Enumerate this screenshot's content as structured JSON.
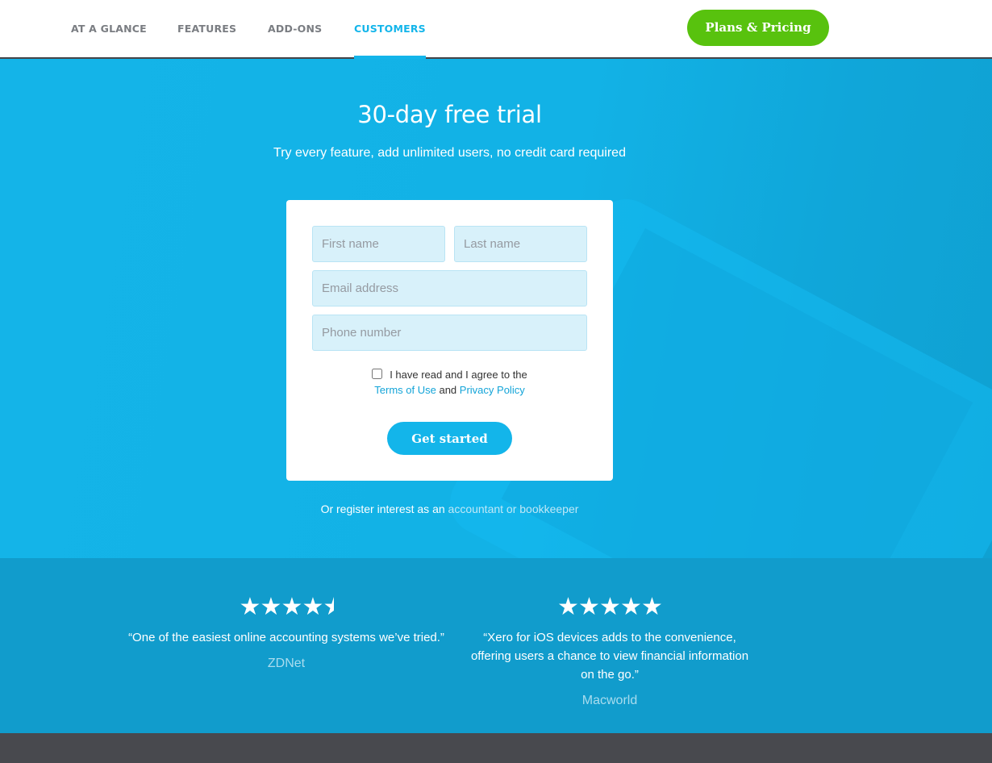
{
  "nav": {
    "items": [
      {
        "label": "AT A GLANCE",
        "active": false
      },
      {
        "label": "FEATURES",
        "active": false
      },
      {
        "label": "ADD-ONS",
        "active": false
      },
      {
        "label": "CUSTOMERS",
        "active": true
      }
    ],
    "cta_label": "Plans & Pricing",
    "cta_color": "#58c20e",
    "accent_color": "#13b5ea"
  },
  "hero": {
    "title": "30-day free trial",
    "subtitle": "Try every feature, add unlimited users, no credit card required",
    "background_color": "#13b5ea"
  },
  "form": {
    "first_name_placeholder": "First name",
    "last_name_placeholder": "Last name",
    "email_placeholder": "Email address",
    "phone_placeholder": "Phone number",
    "first_name_value": "",
    "last_name_value": "",
    "email_value": "",
    "phone_value": "",
    "agree_text": "I have read and I agree to the",
    "agree_checked": false,
    "terms_label": "Terms of Use",
    "and_text": "and",
    "privacy_label": "Privacy Policy",
    "submit_label": "Get started"
  },
  "register": {
    "prefix": "Or register interest as an",
    "link_label": "accountant or bookkeeper"
  },
  "reviews": [
    {
      "rating": 4.5,
      "rating_max": 5,
      "star_glyph": "★",
      "quote": "“One of the easiest online accounting systems we’ve tried.”",
      "source": "ZDNet"
    },
    {
      "rating": 5,
      "rating_max": 5,
      "star_glyph": "★",
      "quote": "“Xero for iOS devices adds to the convenience, offering users a chance to view financial information on the go.”",
      "source": "Macworld"
    }
  ]
}
